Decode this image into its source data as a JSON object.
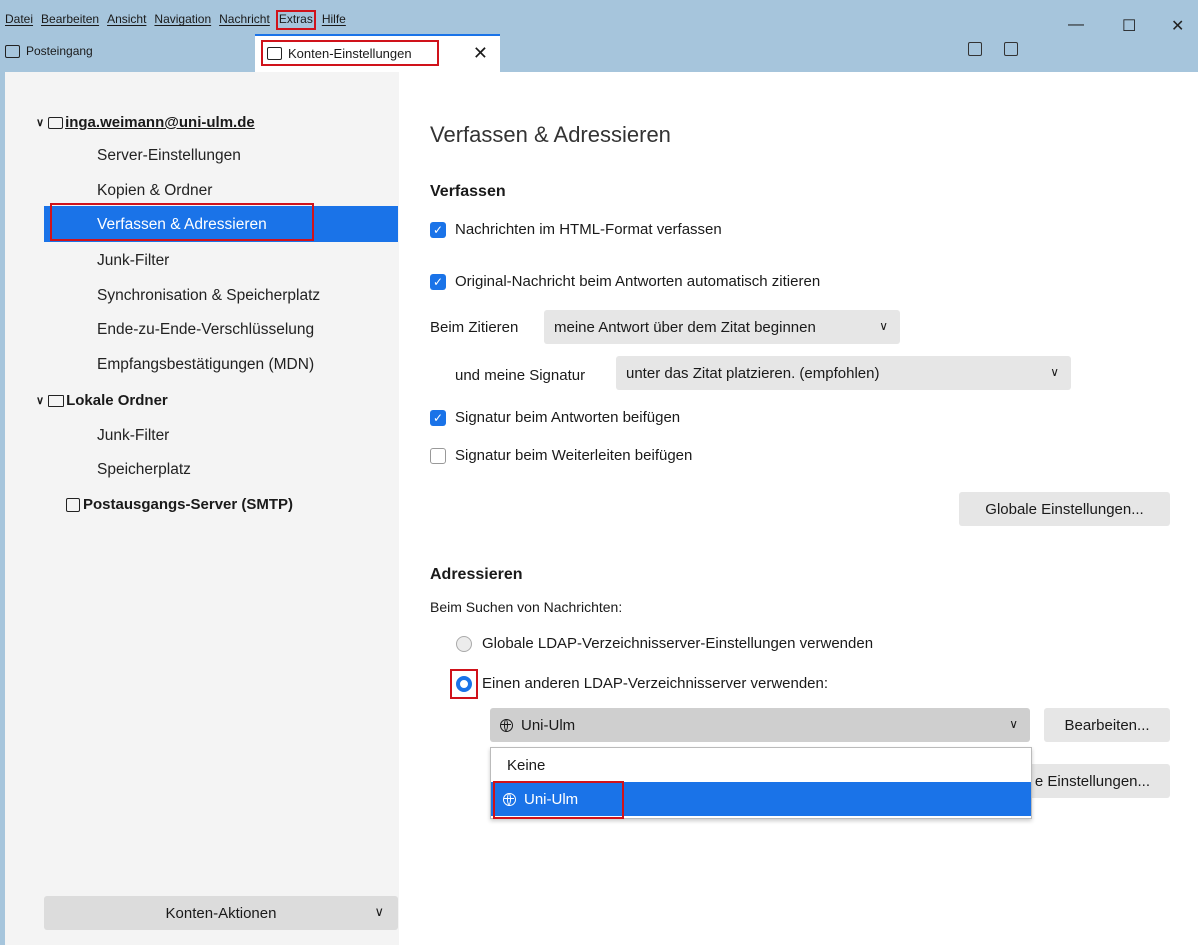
{
  "menubar": [
    "Datei",
    "Bearbeiten",
    "Ansicht",
    "Navigation",
    "Nachricht",
    "Extras",
    "Hilfe"
  ],
  "window_controls": {
    "minimize": "—",
    "maximize": "☐",
    "close": "✕"
  },
  "tabs": {
    "inbox": "Posteingang",
    "settings": "Konten-Einstellungen",
    "close": "✕"
  },
  "sidebar": {
    "account": "inga.weimann@uni-ulm.de",
    "account_items": [
      "Server-Einstellungen",
      "Kopien & Ordner",
      "Verfassen & Adressieren",
      "Junk-Filter",
      "Synchronisation & Speicherplatz",
      "Ende-zu-Ende-Verschlüsselung",
      "Empfangsbestätigungen (MDN)"
    ],
    "local": "Lokale Ordner",
    "local_items": [
      "Junk-Filter",
      "Speicherplatz"
    ],
    "smtp": "Postausgangs-Server (SMTP)",
    "actions": "Konten-Aktionen"
  },
  "content": {
    "title": "Verfassen & Adressieren",
    "compose": {
      "heading": "Verfassen",
      "html_format": "Nachrichten im HTML-Format verfassen",
      "auto_quote": "Original-Nachricht beim Antworten automatisch zitieren",
      "quoting_label": "Beim Zitieren",
      "quoting_value": "meine Antwort über dem Zitat beginnen",
      "signature_label": "und meine Signatur",
      "signature_value": "unter das Zitat platzieren. (empfohlen)",
      "sig_reply": "Signatur beim Antworten beifügen",
      "sig_forward": "Signatur beim Weiterleiten beifügen",
      "global_button": "Globale Einstellungen..."
    },
    "addressing": {
      "heading": "Adressieren",
      "search_label": "Beim Suchen von Nachrichten:",
      "radio_global": "Globale LDAP-Verzeichnisserver-Einstellungen verwenden",
      "radio_other": "Einen anderen LDAP-Verzeichnisserver verwenden:",
      "ldap_value": "Uni-Ulm",
      "edit_button": "Bearbeiten...",
      "hidden_button_tail": "e Einstellungen...",
      "dropdown_options": [
        "Keine",
        "Uni-Ulm"
      ]
    }
  },
  "colors": {
    "accent": "#1a73e8",
    "highlight": "#d0121a",
    "titlebar": "#a6c5dc"
  }
}
